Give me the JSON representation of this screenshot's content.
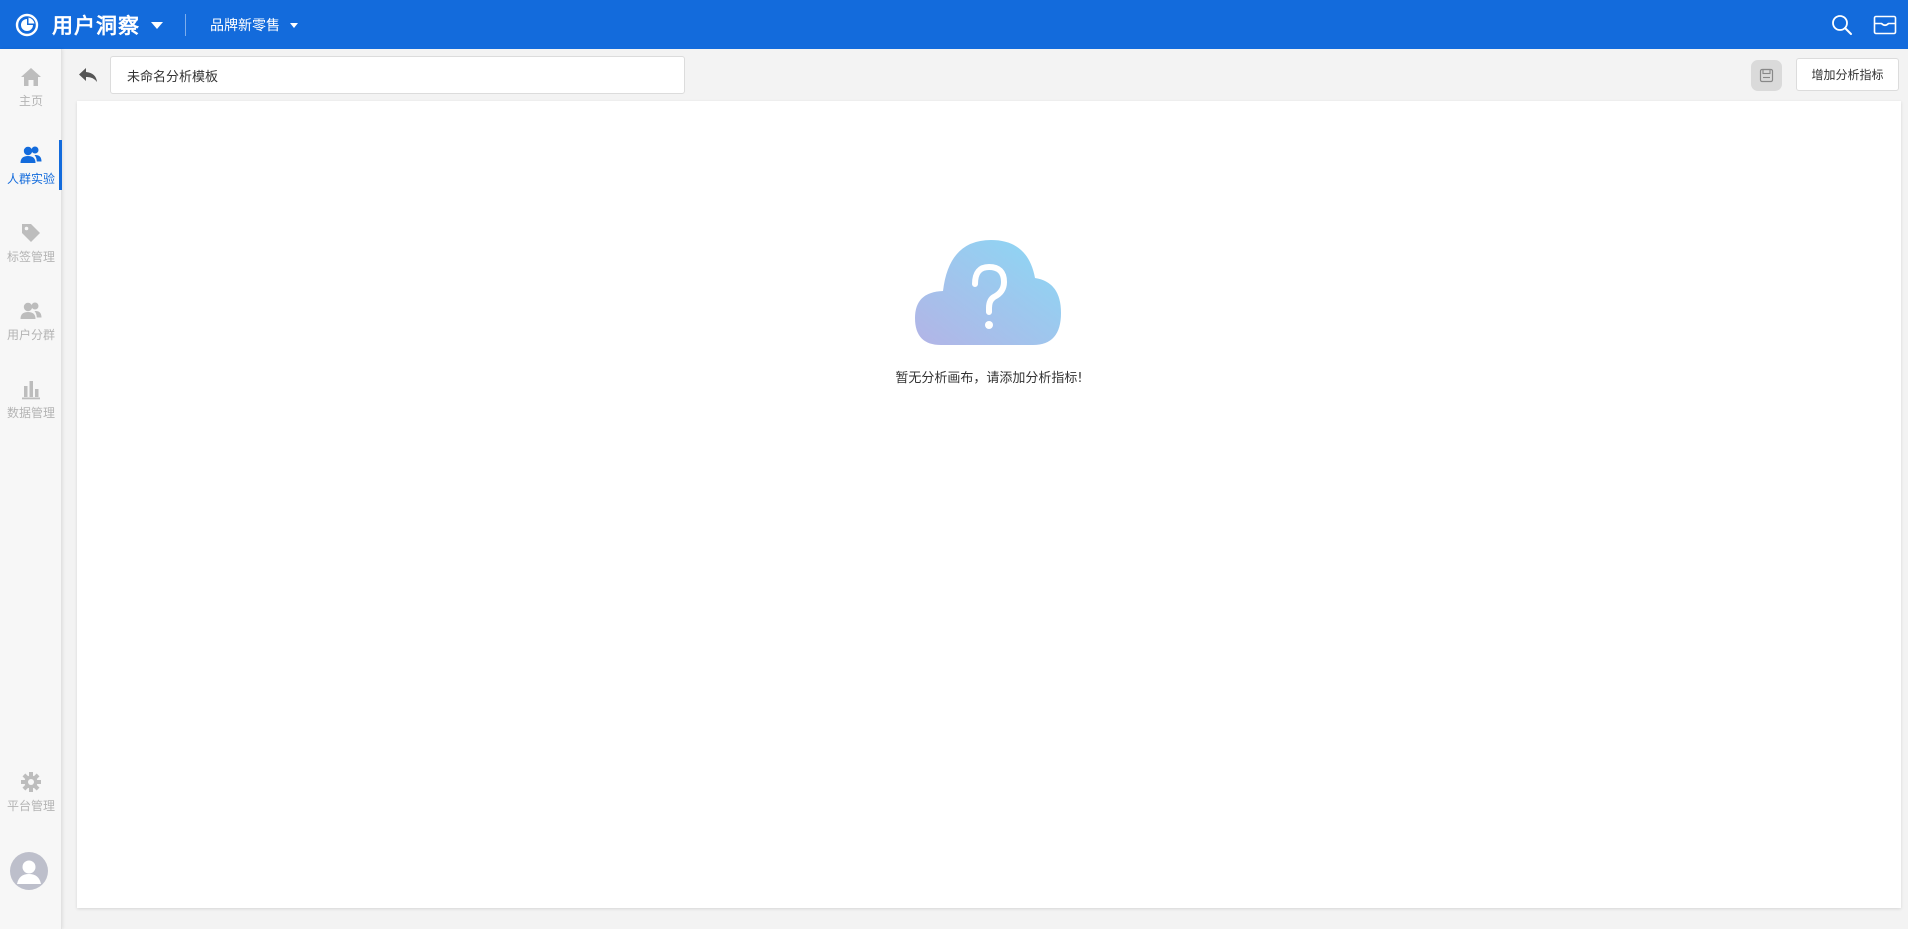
{
  "header": {
    "app_title": "用户洞察",
    "org_name": "品牌新零售",
    "icons": {
      "logo": "pie-chart-logo-icon",
      "search": "search-icon",
      "mail": "mail-icon"
    },
    "bg_color": "#136bdc"
  },
  "sidebar": {
    "items": [
      {
        "label": "主页",
        "icon": "home-icon",
        "active": false
      },
      {
        "label": "人群实验",
        "icon": "users-icon",
        "active": true
      },
      {
        "label": "标签管理",
        "icon": "tag-icon",
        "active": false
      },
      {
        "label": "用户分群",
        "icon": "user-group-icon",
        "active": false
      },
      {
        "label": "数据管理",
        "icon": "bar-chart-icon",
        "active": false
      }
    ],
    "bottom_item": {
      "label": "平台管理",
      "icon": "gear-icon"
    },
    "avatar_icon": "user-avatar-icon",
    "active_color": "#136bdc"
  },
  "toolbar": {
    "back_icon": "back-arrow-icon",
    "template_name_value": "未命名分析模板",
    "save_icon": "save-icon",
    "add_metric_label": "增加分析指标"
  },
  "canvas": {
    "empty_icon": "cloud-question-icon",
    "empty_text": "暂无分析画布，请添加分析指标!"
  }
}
